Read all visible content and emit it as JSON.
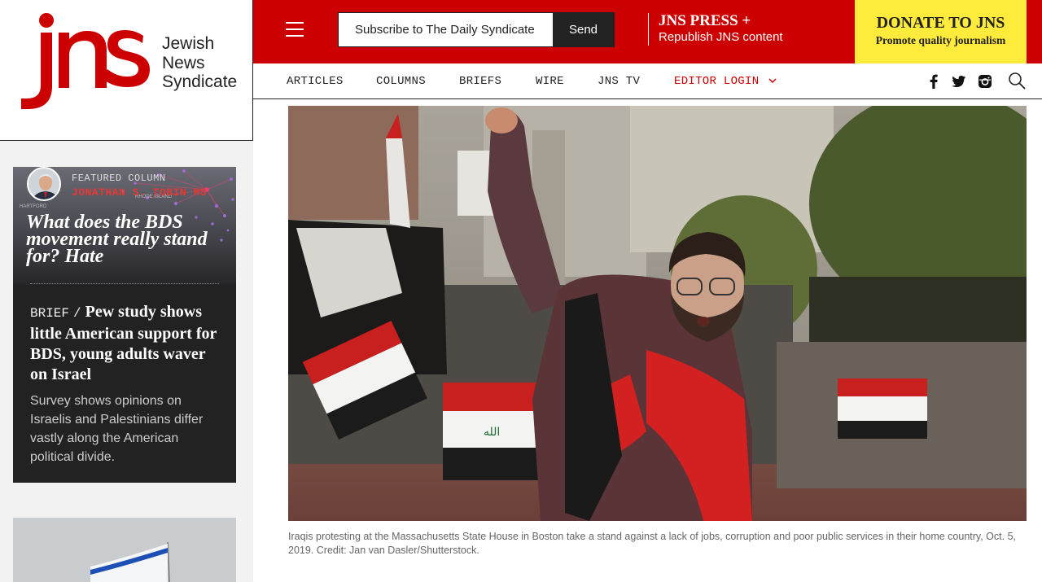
{
  "brand": {
    "logo_letters": "jns",
    "name_line1": "Jewish",
    "name_line2": "News",
    "name_line3": "Syndicate",
    "red": "#cc0000",
    "yellow": "#ffeb3b"
  },
  "topbar": {
    "menu_icon": "hamburger-icon",
    "subscribe_placeholder": "Subscribe to The Daily Syndicate",
    "send_label": "Send",
    "press_title": "JNS PRESS +",
    "press_sub": "Republish JNS content",
    "donate_title": "DONATE TO JNS",
    "donate_sub": "Promote quality journalism"
  },
  "nav": {
    "items": [
      "ARTICLES",
      "COLUMNS",
      "BRIEFS",
      "WIRE",
      "JNS TV"
    ],
    "editor_login": "EDITOR LOGIN",
    "social_icons": [
      "facebook-icon",
      "twitter-icon",
      "instagram-icon"
    ],
    "search_icon": "search-icon"
  },
  "featured": {
    "label": "FEATURED COLUMN",
    "author": "JONATHAN S. TOBIN",
    "author_suffix": "MS",
    "map_label_1": "HARTFORD",
    "map_label_2": "RHODE ISLAND",
    "title": "What does the BDS movement really stand for? Hate"
  },
  "brief": {
    "tag": "BRIEF",
    "separator": "/",
    "title": "Pew study shows little American support for BDS, young adults waver on Israel",
    "summary": "Survey shows opinions on Israelis and Palestinians differ vastly along the American political divide."
  },
  "article": {
    "caption": "Iraqis protesting at the Massachusetts State House in Boston take a stand against a lack of jobs, corruption and poor public services in their home country, Oct. 5, 2019. Credit: Jan van Dasler/Shutterstock."
  }
}
